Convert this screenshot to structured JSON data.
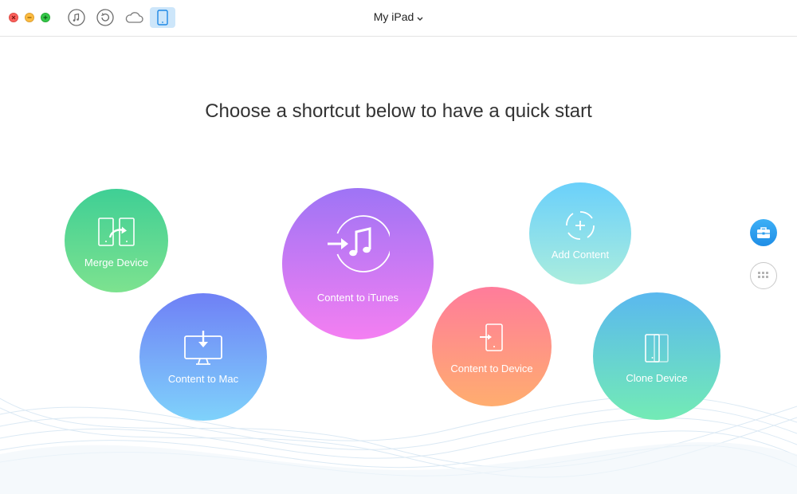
{
  "window": {
    "device_name": "My iPad",
    "toolbar_icons": [
      "music-icon",
      "restore-icon",
      "cloud-icon",
      "ipad-icon"
    ]
  },
  "main": {
    "headline": "Choose a shortcut below to have a quick start",
    "shortcuts": [
      {
        "label": "Merge Device",
        "icon": "merge-device-icon"
      },
      {
        "label": "Content to Mac",
        "icon": "monitor-download-icon"
      },
      {
        "label": "Content to iTunes",
        "icon": "itunes-arrow-icon"
      },
      {
        "label": "Add Content",
        "icon": "add-circle-icon"
      },
      {
        "label": "Content to Device",
        "icon": "device-import-icon"
      },
      {
        "label": "Clone Device",
        "icon": "clone-device-icon"
      }
    ]
  },
  "sidebar": {
    "buttons": [
      "toolbox-icon",
      "grid-icon"
    ]
  },
  "colors": {
    "accent": "#2196f3",
    "merge_gradient": [
      "#3fcf95",
      "#7de28f"
    ],
    "mac_gradient": [
      "#6f80f6",
      "#7fd2fb"
    ],
    "itunes_gradient": [
      "#9e74f5",
      "#f47ff2"
    ],
    "add_gradient": [
      "#6ad0fb",
      "#abeddd"
    ],
    "to_device_gradient": [
      "#ff7c9b",
      "#ffad6f"
    ],
    "clone_gradient": [
      "#5ab8ef",
      "#73ebb5"
    ]
  }
}
